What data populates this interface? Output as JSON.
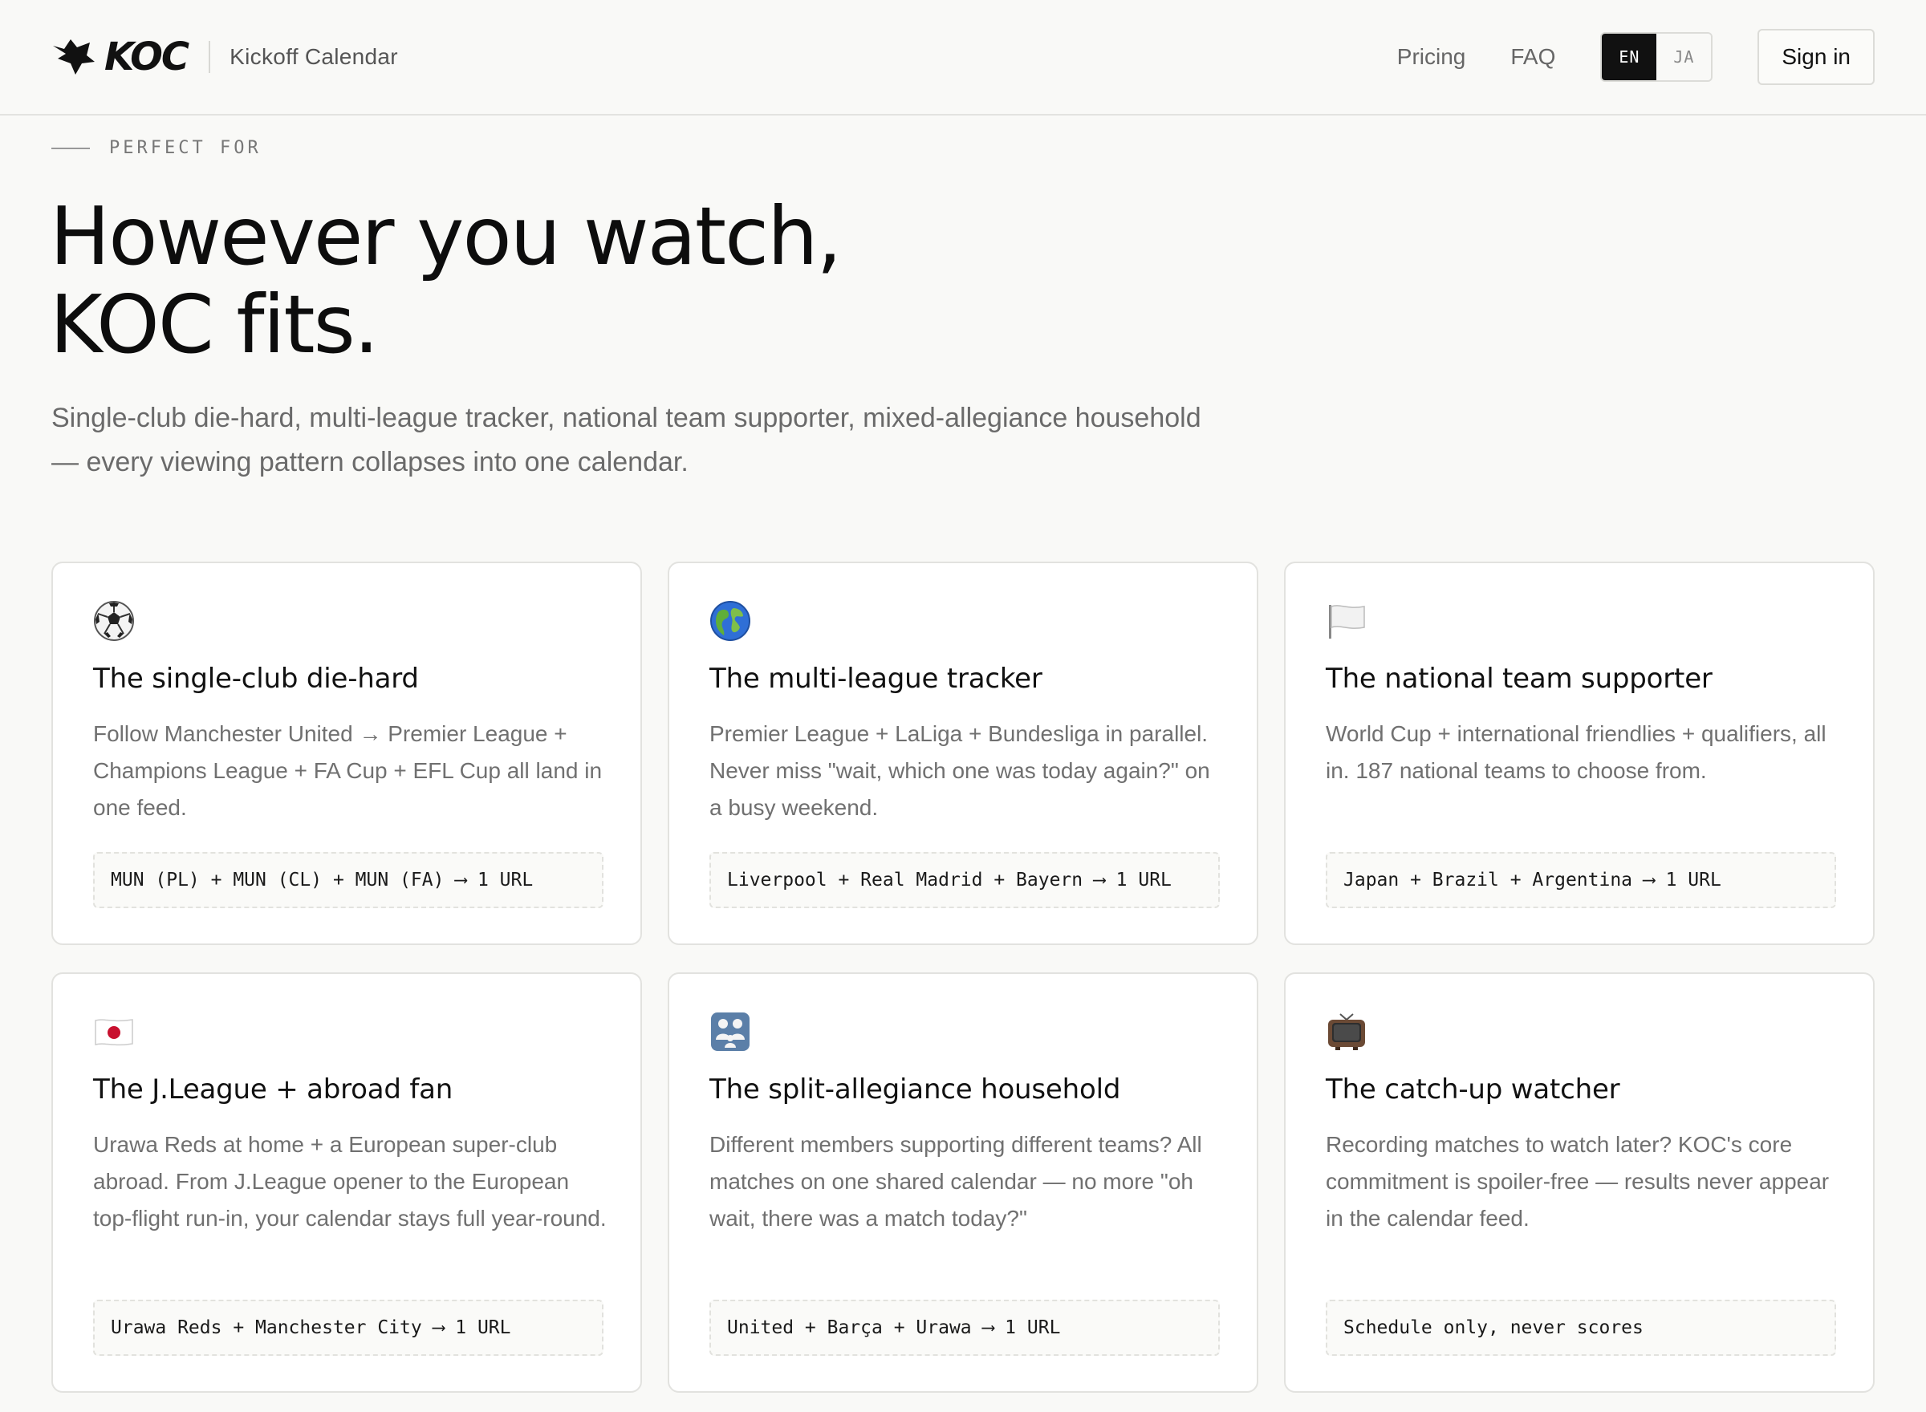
{
  "header": {
    "logo_text": "KOC",
    "brand_sub": "Kickoff Calendar",
    "nav": {
      "pricing": "Pricing",
      "faq": "FAQ"
    },
    "lang": {
      "en": "EN",
      "ja": "JA",
      "active": "EN"
    },
    "sign_in": "Sign in"
  },
  "hero": {
    "eyebrow": "PERFECT FOR",
    "title_line1": "However you watch,",
    "title_line2": "KOC fits.",
    "subtitle": "Single-club die-hard, multi-league tracker, national team supporter, mixed-allegiance household — every viewing pattern collapses into one calendar."
  },
  "cards": [
    {
      "icon": "soccer-ball-icon",
      "title": "The single-club die-hard",
      "description": "Follow Manchester United → Premier League + Champions League + FA Cup + EFL Cup all land in one feed.",
      "code": "MUN (PL) + MUN (CL) + MUN (FA) ⟶ 1 URL"
    },
    {
      "icon": "globe-icon",
      "title": "The multi-league tracker",
      "description": "Premier League + LaLiga + Bundesliga in parallel. Never miss \"wait, which one was today again?\" on a busy weekend.",
      "code": "Liverpool + Real Madrid + Bayern ⟶ 1 URL"
    },
    {
      "icon": "white-flag-icon",
      "title": "The national team supporter",
      "description": "World Cup + international friendlies + qualifiers, all in. 187 national teams to choose from.",
      "code": "Japan + Brazil + Argentina ⟶ 1 URL"
    },
    {
      "icon": "japan-flag-icon",
      "title": "The J.League + abroad fan",
      "description": "Urawa Reds at home + a European super-club abroad. From J.League opener to the European top-flight run-in, your calendar stays full year-round.",
      "code": "Urawa Reds + Manchester City ⟶ 1 URL"
    },
    {
      "icon": "family-icon",
      "title": "The split-allegiance household",
      "description": "Different members supporting different teams? All matches on one shared calendar — no more \"oh wait, there was a match today?\"",
      "code": "United + Barça + Urawa ⟶ 1 URL"
    },
    {
      "icon": "television-icon",
      "title": "The catch-up watcher",
      "description": "Recording matches to watch later? KOC's core commitment is spoiler-free — results never appear in the calendar feed.",
      "code": "Schedule only, never scores"
    }
  ]
}
